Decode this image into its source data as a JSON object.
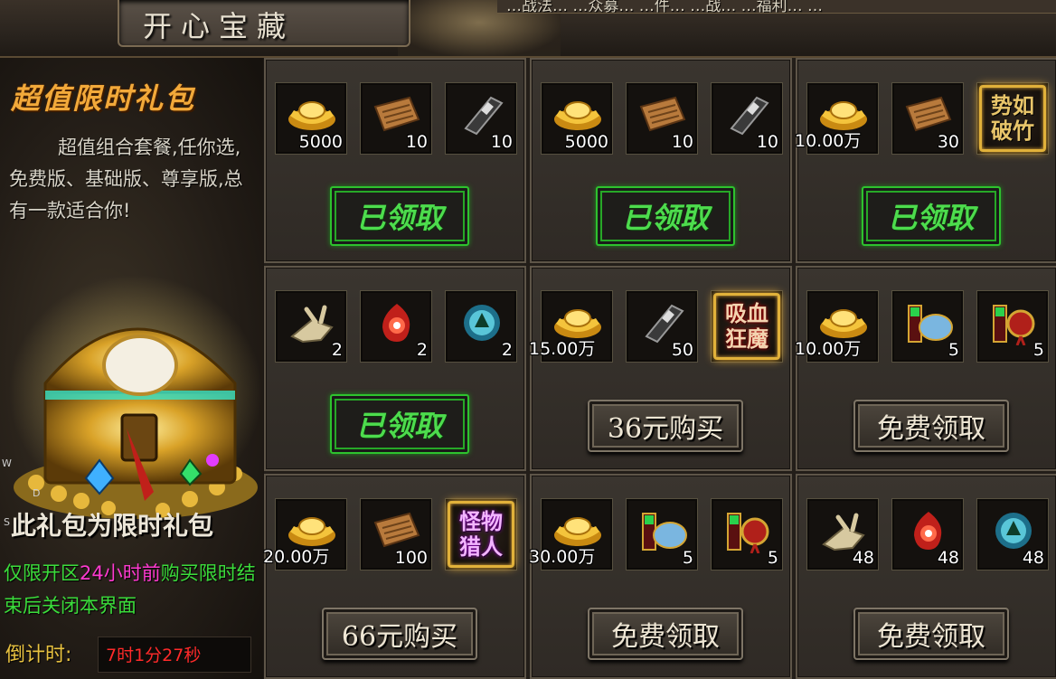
{
  "window": {
    "title": "开心宝藏"
  },
  "ticker": {
    "text": "…战法…  …众募…  …件…  …战…  …福利…  …"
  },
  "left_panel": {
    "headline": "超值限时礼包",
    "description": "超值组合套餐,任你选,免费版、基础版、尊享版,总有一款适合你!",
    "limit_title": "此礼包为限时礼包",
    "limit_desc_pre": "仅限开区",
    "limit_desc_highlight": "24小时前",
    "limit_desc_post": "购买限时结束后关闭本界面",
    "countdown_label": "倒计时:",
    "countdown_value": "7时1分27秒",
    "stray_letters": [
      "W",
      "D",
      "S"
    ]
  },
  "packs": [
    {
      "items": [
        {
          "icon": "gold-ingot-icon",
          "qty": "5000"
        },
        {
          "icon": "scroll-icon",
          "qty": "10"
        },
        {
          "icon": "book-icon",
          "qty": "10"
        }
      ],
      "button": {
        "kind": "claimed",
        "label": "已领取"
      }
    },
    {
      "items": [
        {
          "icon": "gold-ingot-icon",
          "qty": "5000"
        },
        {
          "icon": "scroll-icon",
          "qty": "10"
        },
        {
          "icon": "book-icon",
          "qty": "10"
        }
      ],
      "button": {
        "kind": "claimed",
        "label": "已领取"
      }
    },
    {
      "items": [
        {
          "icon": "gold-ingot-icon",
          "qty": "10.00万"
        },
        {
          "icon": "scroll-icon",
          "qty": "30"
        },
        {
          "icon": "skill-icon",
          "skill": "势如破竹",
          "tone": "gold"
        }
      ],
      "button": {
        "kind": "claimed",
        "label": "已领取"
      }
    },
    {
      "items": [
        {
          "icon": "bone-icon",
          "qty": "2"
        },
        {
          "icon": "red-flame-gem-icon",
          "qty": "2"
        },
        {
          "icon": "blue-orb-icon",
          "qty": "2"
        }
      ],
      "button": {
        "kind": "claimed",
        "label": "已领取"
      }
    },
    {
      "items": [
        {
          "icon": "gold-ingot-icon",
          "qty": "15.00万"
        },
        {
          "icon": "book-icon",
          "qty": "50"
        },
        {
          "icon": "skill-icon",
          "skill": "吸血狂魔",
          "tone": "red"
        }
      ],
      "button": {
        "kind": "buy",
        "label": "36元购买"
      }
    },
    {
      "items": [
        {
          "icon": "gold-ingot-icon",
          "qty": "10.00万"
        },
        {
          "icon": "bowl-box-icon",
          "qty": "5"
        },
        {
          "icon": "red-charm-icon",
          "qty": "5"
        }
      ],
      "button": {
        "kind": "buy",
        "label": "免费领取"
      }
    },
    {
      "items": [
        {
          "icon": "gold-ingot-icon",
          "qty": "20.00万"
        },
        {
          "icon": "scroll-icon",
          "qty": "100"
        },
        {
          "icon": "skill-icon",
          "skill": "怪物猎人",
          "tone": "pink"
        }
      ],
      "button": {
        "kind": "buy",
        "label": "66元购买"
      }
    },
    {
      "items": [
        {
          "icon": "gold-ingot-icon",
          "qty": "30.00万"
        },
        {
          "icon": "bowl-box-icon",
          "qty": "5"
        },
        {
          "icon": "red-charm-icon",
          "qty": "5"
        }
      ],
      "button": {
        "kind": "buy",
        "label": "免费领取"
      }
    },
    {
      "items": [
        {
          "icon": "bone-icon",
          "qty": "48"
        },
        {
          "icon": "red-flame-gem-icon",
          "qty": "48"
        },
        {
          "icon": "blue-orb-icon",
          "qty": "48"
        }
      ],
      "button": {
        "kind": "buy",
        "label": "免费领取"
      }
    }
  ]
}
